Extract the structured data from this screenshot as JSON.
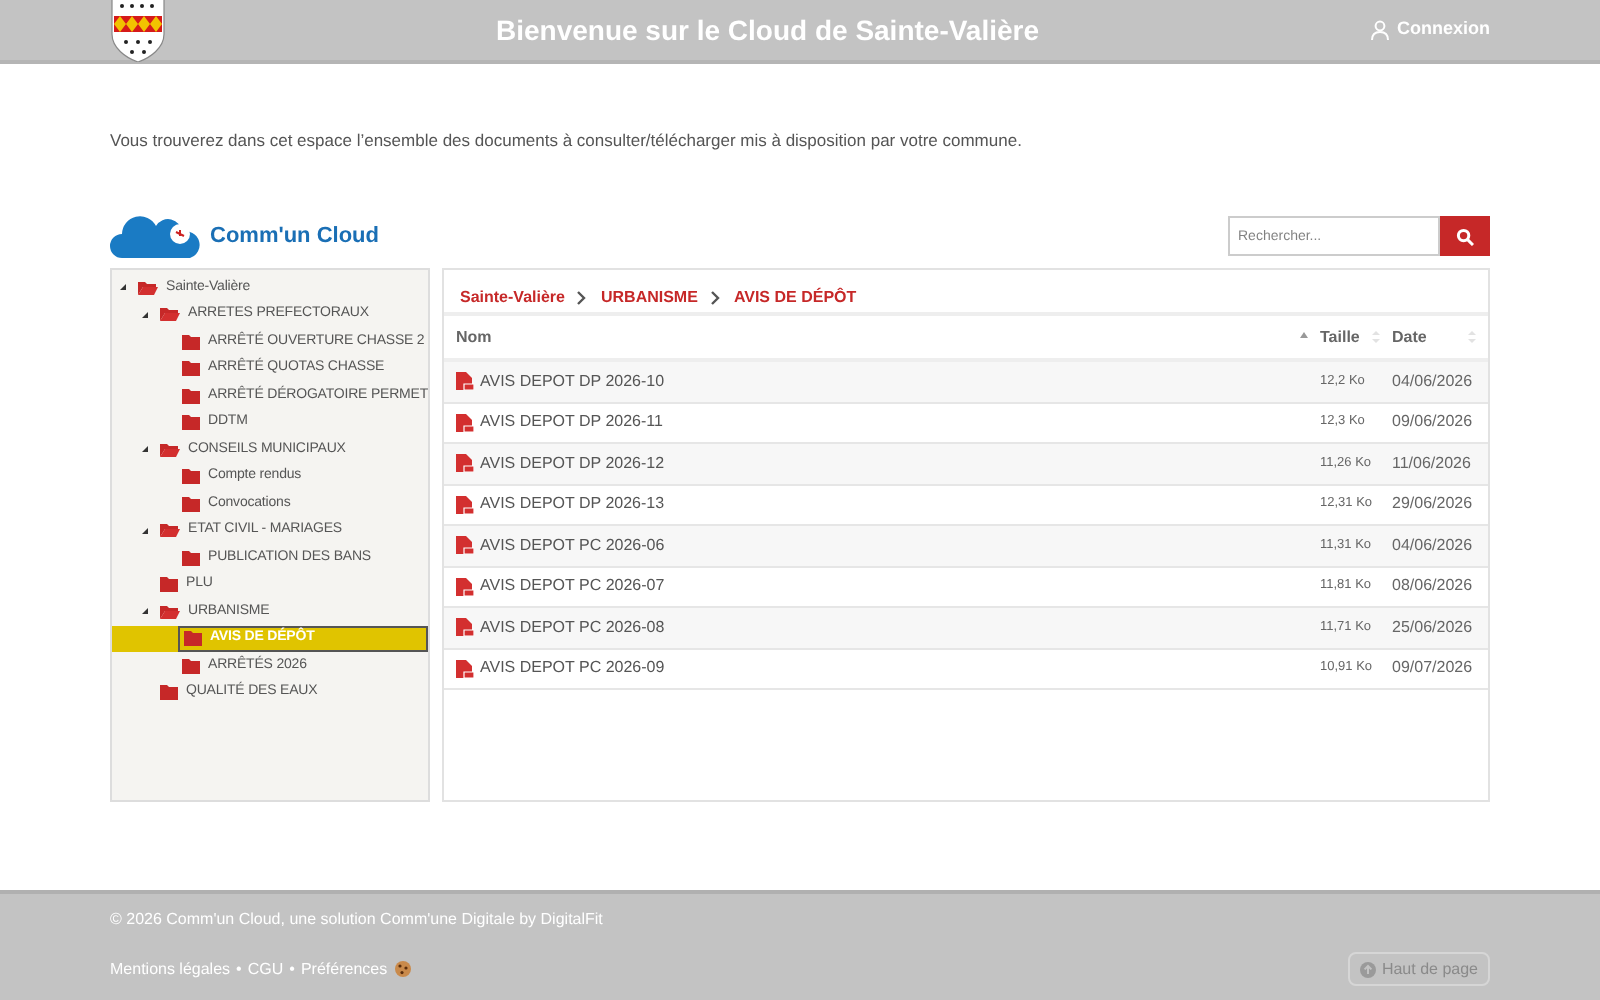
{
  "header": {
    "title": "Bienvenue sur le Cloud de Sainte-Valière",
    "login": "Connexion"
  },
  "intro": "Vous trouverez dans cet espace l’ensemble des documents à consulter/télécharger mis à disposition par votre commune.",
  "brand": "Comm'un Cloud",
  "search": {
    "placeholder": "Rechercher..."
  },
  "tree": [
    {
      "label": "Sainte-Valière",
      "expanded": true,
      "selected": false,
      "children": [
        {
          "label": "ARRETES PREFECTORAUX",
          "expanded": true,
          "selected": false,
          "children": [
            {
              "label": "ARRÊTÉ OUVERTURE CHASSE 2",
              "expanded": false,
              "selected": false
            },
            {
              "label": "ARRÊTÉ QUOTAS CHASSE",
              "expanded": false,
              "selected": false
            },
            {
              "label": "ARRÊTÉ DÉROGATOIRE PERMET",
              "expanded": false,
              "selected": false
            },
            {
              "label": "DDTM",
              "expanded": false,
              "selected": false
            }
          ]
        },
        {
          "label": "CONSEILS MUNICIPAUX",
          "expanded": true,
          "selected": false,
          "children": [
            {
              "label": "Compte rendus",
              "expanded": false,
              "selected": false
            },
            {
              "label": "Convocations",
              "expanded": false,
              "selected": false
            }
          ]
        },
        {
          "label": "ETAT CIVIL - MARIAGES",
          "expanded": true,
          "selected": false,
          "children": [
            {
              "label": "PUBLICATION DES BANS",
              "expanded": false,
              "selected": false
            }
          ]
        },
        {
          "label": "PLU",
          "expanded": false,
          "selected": false
        },
        {
          "label": "URBANISME",
          "expanded": true,
          "selected": false,
          "children": [
            {
              "label": "AVIS DE DÉPÔT",
              "expanded": false,
              "selected": true
            },
            {
              "label": "ARRÊTÉS 2026",
              "expanded": false,
              "selected": false
            }
          ]
        },
        {
          "label": "QUALITÉ DES EAUX",
          "expanded": false,
          "selected": false
        }
      ]
    }
  ],
  "breadcrumb": [
    "Sainte-Valière",
    "URBANISME",
    "AVIS DE DÉPÔT"
  ],
  "table": {
    "columns": [
      {
        "label": "Nom",
        "sorted": true
      },
      {
        "label": "Taille",
        "sorted": false
      },
      {
        "label": "Date",
        "sorted": false
      }
    ],
    "rows": [
      {
        "name": "AVIS DEPOT DP 2026-10",
        "size": "12,2 Ko",
        "date": "04/06/2026"
      },
      {
        "name": "AVIS DEPOT DP 2026-11",
        "size": "12,3 Ko",
        "date": "09/06/2026"
      },
      {
        "name": "AVIS DEPOT DP 2026-12",
        "size": "11,26 Ko",
        "date": "11/06/2026"
      },
      {
        "name": "AVIS DEPOT DP 2026-13",
        "size": "12,31 Ko",
        "date": "29/06/2026"
      },
      {
        "name": "AVIS DEPOT PC 2026-06",
        "size": "11,31 Ko",
        "date": "04/06/2026"
      },
      {
        "name": "AVIS DEPOT PC 2026-07",
        "size": "11,81 Ko",
        "date": "08/06/2026"
      },
      {
        "name": "AVIS DEPOT PC 2026-08",
        "size": "11,71 Ko",
        "date": "25/06/2026"
      },
      {
        "name": "AVIS DEPOT PC 2026-09",
        "size": "10,91 Ko",
        "date": "09/07/2026"
      }
    ]
  },
  "footer": {
    "copyright": "© 2026 Comm'un Cloud, une solution Comm'une Digitale by DigitalFit",
    "links": [
      "Mentions légales",
      "CGU",
      "Préférences"
    ],
    "separator": "•",
    "top_button": "Haut de page"
  }
}
